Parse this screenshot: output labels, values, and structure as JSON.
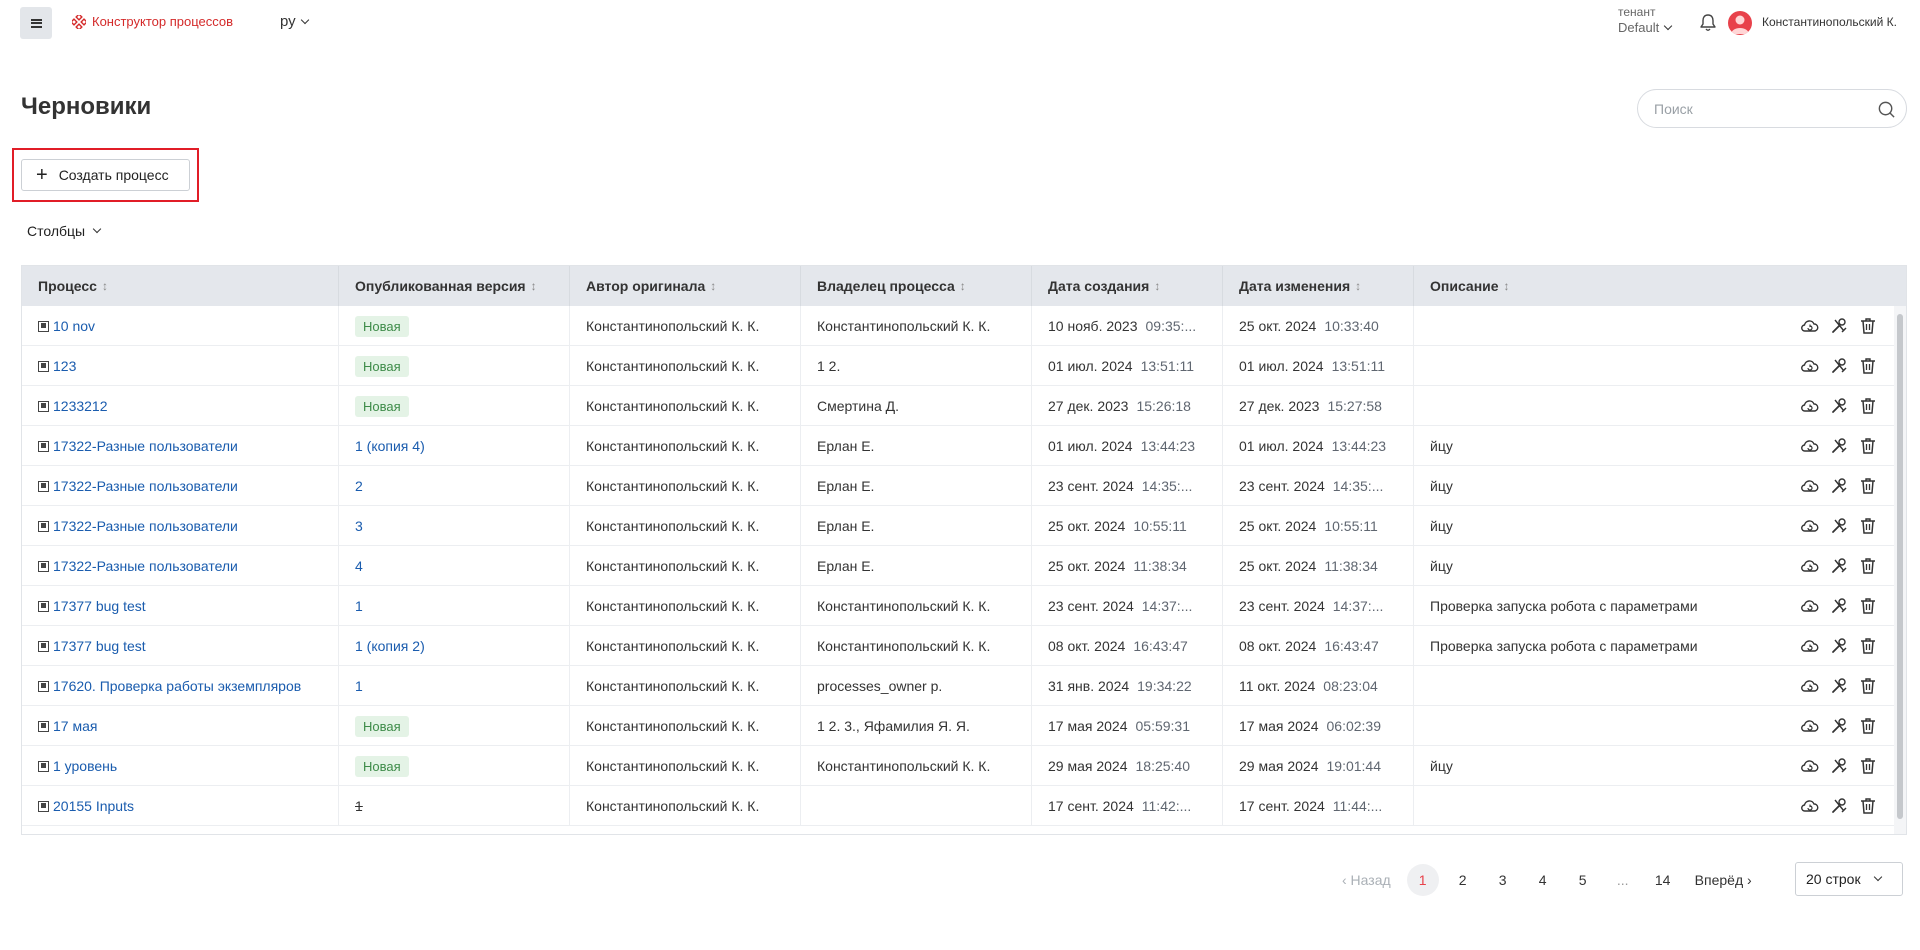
{
  "header": {
    "brand": "Конструктор процессов",
    "language": "ру",
    "tenant_label": "тенант",
    "tenant_value": "Default",
    "user_name": "Константинопольский К."
  },
  "page": {
    "title": "Черновики",
    "search_placeholder": "Поиск",
    "create_button": "Создать процесс",
    "columns_button": "Столбцы"
  },
  "table": {
    "headers": [
      "Процесс",
      "Опубликованная версия",
      "Автор оригинала",
      "Владелец процесса",
      "Дата создания",
      "Дата изменения",
      "Описание"
    ],
    "rows": [
      {
        "process": "10 nov",
        "version": "Новая",
        "version_type": "badge",
        "author": "Константинопольский К. К.",
        "owner": "Константинопольский К. К.",
        "created_date": "10 нояб. 2023",
        "created_time": "09:35:...",
        "modified_date": "25 окт. 2024",
        "modified_time": "10:33:40",
        "description": ""
      },
      {
        "process": "123",
        "version": "Новая",
        "version_type": "badge",
        "author": "Константинопольский К. К.",
        "owner": "1 2.",
        "created_date": "01 июл. 2024",
        "created_time": "13:51:11",
        "modified_date": "01 июл. 2024",
        "modified_time": "13:51:11",
        "description": ""
      },
      {
        "process": "1233212",
        "version": "Новая",
        "version_type": "badge",
        "author": "Константинопольский К. К.",
        "owner": "Смертина Д.",
        "created_date": "27 дек. 2023",
        "created_time": "15:26:18",
        "modified_date": "27 дек. 2023",
        "modified_time": "15:27:58",
        "description": ""
      },
      {
        "process": "17322-Разные пользователи",
        "version": "1 (копия 4)",
        "version_type": "link",
        "author": "Константинопольский К. К.",
        "owner": "Ерлан Е.",
        "created_date": "01 июл. 2024",
        "created_time": "13:44:23",
        "modified_date": "01 июл. 2024",
        "modified_time": "13:44:23",
        "description": "йцу"
      },
      {
        "process": "17322-Разные пользователи",
        "version": "2",
        "version_type": "link",
        "author": "Константинопольский К. К.",
        "owner": "Ерлан Е.",
        "created_date": "23 сент. 2024",
        "created_time": "14:35:...",
        "modified_date": "23 сент. 2024",
        "modified_time": "14:35:...",
        "description": "йцу"
      },
      {
        "process": "17322-Разные пользователи",
        "version": "3",
        "version_type": "link",
        "author": "Константинопольский К. К.",
        "owner": "Ерлан Е.",
        "created_date": "25 окт. 2024",
        "created_time": "10:55:11",
        "modified_date": "25 окт. 2024",
        "modified_time": "10:55:11",
        "description": "йцу"
      },
      {
        "process": "17322-Разные пользователи",
        "version": "4",
        "version_type": "link",
        "author": "Константинопольский К. К.",
        "owner": "Ерлан Е.",
        "created_date": "25 окт. 2024",
        "created_time": "11:38:34",
        "modified_date": "25 окт. 2024",
        "modified_time": "11:38:34",
        "description": "йцу"
      },
      {
        "process": "17377 bug test",
        "version": "1",
        "version_type": "link",
        "author": "Константинопольский К. К.",
        "owner": "Константинопольский К. К.",
        "created_date": "23 сент. 2024",
        "created_time": "14:37:...",
        "modified_date": "23 сент. 2024",
        "modified_time": "14:37:...",
        "description": "Проверка запуска робота с параметрами"
      },
      {
        "process": "17377 bug test",
        "version": "1 (копия 2)",
        "version_type": "link",
        "author": "Константинопольский К. К.",
        "owner": "Константинопольский К. К.",
        "created_date": "08 окт. 2024",
        "created_time": "16:43:47",
        "modified_date": "08 окт. 2024",
        "modified_time": "16:43:47",
        "description": "Проверка запуска робота с параметрами"
      },
      {
        "process": "17620. Проверка работы экземпляров",
        "version": "1",
        "version_type": "link",
        "author": "Константинопольский К. К.",
        "owner": "processes_owner p.",
        "created_date": "31 янв. 2024",
        "created_time": "19:34:22",
        "modified_date": "11 окт. 2024",
        "modified_time": "08:23:04",
        "description": ""
      },
      {
        "process": "17 мая",
        "version": "Новая",
        "version_type": "badge",
        "author": "Константинопольский К. К.",
        "owner": "1 2. 3., Яфамилия Я. Я.",
        "created_date": "17 мая 2024",
        "created_time": "05:59:31",
        "modified_date": "17 мая 2024",
        "modified_time": "06:02:39",
        "description": ""
      },
      {
        "process": "1 уровень",
        "version": "Новая",
        "version_type": "badge",
        "author": "Константинопольский К. К.",
        "owner": "Константинопольский К. К.",
        "created_date": "29 мая 2024",
        "created_time": "18:25:40",
        "modified_date": "29 мая 2024",
        "modified_time": "19:01:44",
        "description": "йцу"
      },
      {
        "process": "20155 Inputs",
        "version": "1",
        "version_type": "strike",
        "author": "Константинопольский К. К.",
        "owner": "",
        "created_date": "17 сент. 2024",
        "created_time": "11:42:...",
        "modified_date": "17 сент. 2024",
        "modified_time": "11:44:...",
        "description": ""
      }
    ]
  },
  "pagination": {
    "prev": "‹ Назад",
    "pages": [
      "1",
      "2",
      "3",
      "4",
      "5",
      "...",
      "14"
    ],
    "active": "1",
    "next": "Вперёд ›",
    "rows_per_page": "20 строк"
  },
  "colors": {
    "accent": "#e8414a",
    "link": "#1a5cae",
    "badge_bg": "#e4f3e6",
    "badge_text": "#3d8b48",
    "highlight_border": "#e11d27"
  }
}
